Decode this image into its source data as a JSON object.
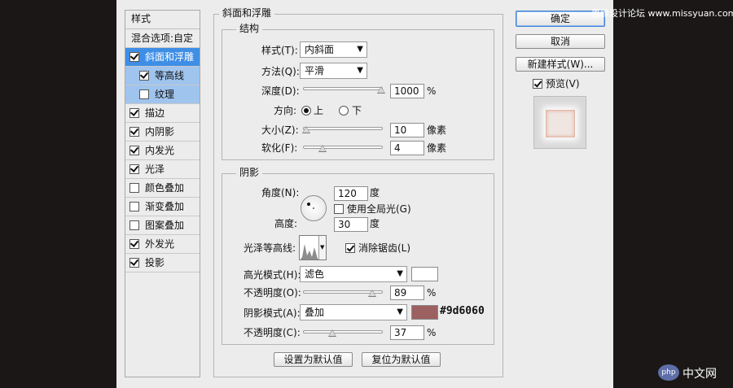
{
  "watermark": "思缘设计论坛 www.missyuan.com",
  "styles_panel": {
    "header": "样式",
    "blend_options": "混合选项:自定",
    "items": [
      {
        "label": "斜面和浮雕",
        "checked": true,
        "state": "selected"
      },
      {
        "label": "等高线",
        "checked": true,
        "state": "sub"
      },
      {
        "label": "纹理",
        "checked": false,
        "state": "sub"
      },
      {
        "label": "描边",
        "checked": true,
        "state": ""
      },
      {
        "label": "内阴影",
        "checked": true,
        "state": ""
      },
      {
        "label": "内发光",
        "checked": true,
        "state": ""
      },
      {
        "label": "光泽",
        "checked": true,
        "state": ""
      },
      {
        "label": "颜色叠加",
        "checked": false,
        "state": ""
      },
      {
        "label": "渐变叠加",
        "checked": false,
        "state": ""
      },
      {
        "label": "图案叠加",
        "checked": false,
        "state": ""
      },
      {
        "label": "外发光",
        "checked": true,
        "state": ""
      },
      {
        "label": "投影",
        "checked": true,
        "state": ""
      }
    ]
  },
  "bevel": {
    "title": "斜面和浮雕",
    "structure": {
      "title": "结构",
      "style_label": "样式(T):",
      "style_value": "内斜面",
      "technique_label": "方法(Q):",
      "technique_value": "平滑",
      "depth_label": "深度(D):",
      "depth_value": "1000",
      "depth_unit": "%",
      "depth_level": 1.0,
      "direction_label": "方向:",
      "direction_up": "上",
      "direction_down": "下",
      "size_label": "大小(Z):",
      "size_value": "10",
      "size_unit": "像素",
      "size_level": 0.04,
      "soften_label": "软化(F):",
      "soften_value": "4",
      "soften_unit": "像素",
      "soften_level": 0.25
    },
    "shading": {
      "title": "阴影",
      "angle_label": "角度(N):",
      "angle_value": "120",
      "angle_unit": "度",
      "global_light_label": "使用全局光(G)",
      "altitude_label": "高度:",
      "altitude_value": "30",
      "altitude_unit": "度",
      "gloss_contour_label": "光泽等高线:",
      "anti_aliased_label": "消除锯齿(L)",
      "highlight_mode_label": "高光模式(H):",
      "highlight_mode_value": "滤色",
      "highlight_color": "#ffffff",
      "highlight_opacity_label": "不透明度(O):",
      "highlight_opacity_value": "89",
      "highlight_opacity_unit": "%",
      "highlight_opacity_level": 0.89,
      "shadow_mode_label": "阴影模式(A):",
      "shadow_mode_value": "叠加",
      "shadow_color": "#9d6060",
      "shadow_color_text": "#9d6060",
      "shadow_opacity_label": "不透明度(C):",
      "shadow_opacity_value": "37",
      "shadow_opacity_unit": "%",
      "shadow_opacity_level": 0.37
    },
    "make_default": "设置为默认值",
    "reset_default": "复位为默认值"
  },
  "buttons": {
    "ok": "确定",
    "cancel": "取消",
    "new_style": "新建样式(W)...",
    "preview": "预览(V)"
  },
  "footer_logo": {
    "badge": "php",
    "text": "中文网"
  }
}
